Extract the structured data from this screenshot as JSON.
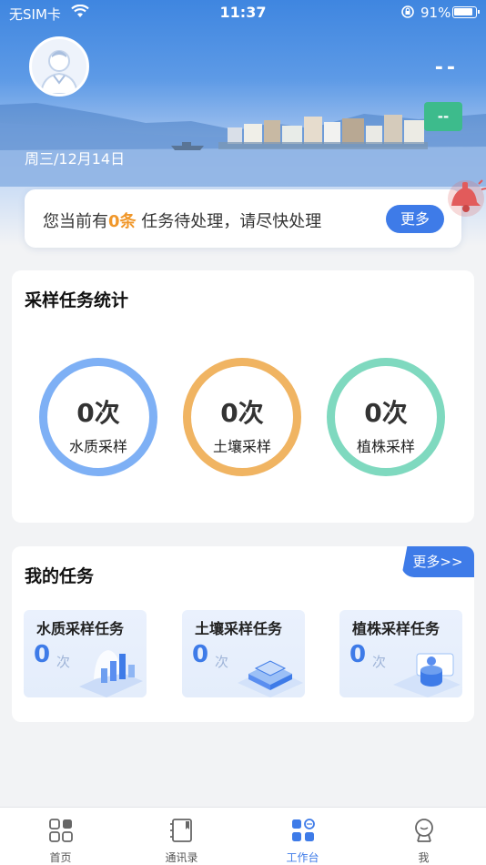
{
  "status_bar": {
    "carrier": "无SIM卡",
    "time": "11:37",
    "battery": "91%"
  },
  "header": {
    "user_name": "--",
    "role_badge": "--",
    "date": "周三/12月14日"
  },
  "notice": {
    "prefix": "您当前有",
    "count": "0条",
    "suffix": " 任务待处理，请尽快处理",
    "more_label": "更多"
  },
  "stats": {
    "title": "采样任务统计",
    "items": [
      {
        "value": "0次",
        "label": "水质采样",
        "color": "#7eb0f5"
      },
      {
        "value": "0次",
        "label": "土壤采样",
        "color": "#f0b462"
      },
      {
        "value": "0次",
        "label": "植株采样",
        "color": "#7fd9bf"
      }
    ]
  },
  "tasks": {
    "title": "我的任务",
    "more_label": "更多>>",
    "items": [
      {
        "name": "水质采样任务",
        "count": "0",
        "unit": "次",
        "icon": "bar-chart-illustration-icon"
      },
      {
        "name": "土壤采样任务",
        "count": "0",
        "unit": "次",
        "icon": "layered-box-illustration-icon"
      },
      {
        "name": "植株采样任务",
        "count": "0",
        "unit": "次",
        "icon": "sensor-device-illustration-icon"
      }
    ]
  },
  "tabbar": {
    "tabs": [
      {
        "label": "首页",
        "icon": "grid-home-icon",
        "active": false
      },
      {
        "label": "通讯录",
        "icon": "address-book-icon",
        "active": false
      },
      {
        "label": "工作台",
        "icon": "workbench-icon",
        "active": true
      },
      {
        "label": "我",
        "icon": "profile-icon",
        "active": false
      }
    ]
  }
}
